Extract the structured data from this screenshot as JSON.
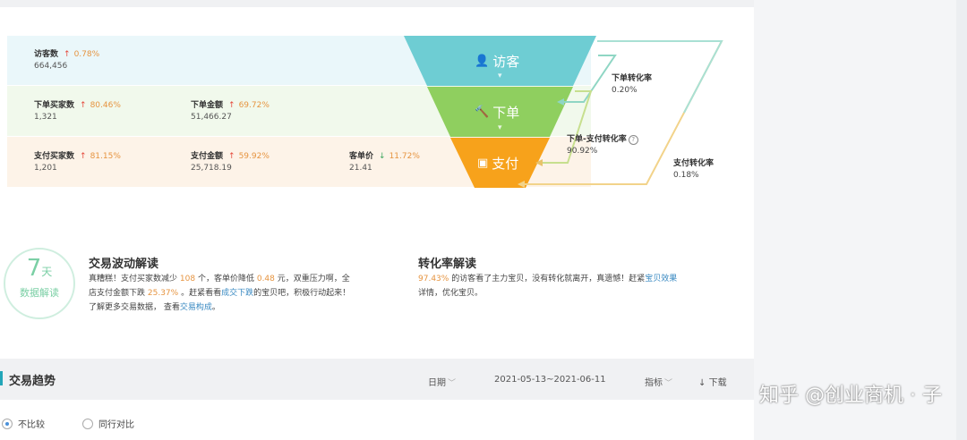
{
  "funnel": {
    "visitor": {
      "label": "访客数",
      "pct": "0.78%",
      "value": "664,456",
      "stage": "访客"
    },
    "order": {
      "stage": "下单",
      "buyers": {
        "label": "下单买家数",
        "pct": "80.46%",
        "value": "1,321"
      },
      "amount": {
        "label": "下单金额",
        "pct": "69.72%",
        "value": "51,466.27"
      }
    },
    "pay": {
      "stage": "支付",
      "buyers": {
        "label": "支付买家数",
        "pct": "81.15%",
        "value": "1,201"
      },
      "amount": {
        "label": "支付金额",
        "pct": "59.92%",
        "value": "25,718.19"
      },
      "unit_price": {
        "label": "客单价",
        "pct": "11.72%",
        "value": "21.41"
      }
    }
  },
  "conversions": {
    "order_rate": {
      "label": "下单转化率",
      "value": "0.20%"
    },
    "order_pay_rate": {
      "label": "下单-支付转化率",
      "value": "90.92%",
      "help": "?"
    },
    "pay_rate": {
      "label": "支付转化率",
      "value": "0.18%"
    }
  },
  "badge": {
    "num": "7",
    "unit": "天",
    "caption": "数据解读"
  },
  "trade_analysis": {
    "title": "交易波动解读",
    "p1": "真糟糕！支付买家数减少",
    "v1": "108",
    "p2": "个，客单价降低",
    "v2": "0.48",
    "p3": "元，双重压力啊，全",
    "p4": "店支付金额下跌",
    "v3": "25.37%",
    "p5": "。赶紧看看",
    "link1": "成交下跌",
    "p6": "的宝贝吧，积极行动起来！",
    "p7": "了解更多交易数据，  查看",
    "link2": "交易构成",
    "p8": "。"
  },
  "conversion_analysis": {
    "title": "转化率解读",
    "v1": "97.43%",
    "p1": "的访客看了主力宝贝，没有转化就离开，真遗憾！赶紧",
    "link1": "宝贝效果",
    "p2": "详情，优化宝贝。"
  },
  "trend": {
    "title": "交易趋势",
    "date_label": "日期",
    "date_range": "2021-05-13~2021-06-11",
    "metric_label": "指标",
    "download": "下载",
    "compare_none": "不比较",
    "compare_peer": "同行对比"
  },
  "watermark": "知乎 @创业商机 · 子",
  "colors": {
    "teal": "#6ecdd3",
    "green": "#8fcf5f",
    "orange": "#f7a21b",
    "up": "#e5473a",
    "down": "#3aa55d",
    "accent": "#23a6b8"
  }
}
